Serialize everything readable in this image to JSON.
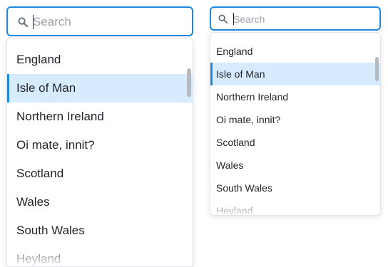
{
  "colors": {
    "accent": "#1f86e2",
    "selected_bg": "#d6ebfd",
    "text": "#1f2328",
    "placeholder": "#9aa1a9"
  },
  "large_combo": {
    "search": {
      "icon": "search-icon",
      "placeholder": "Search",
      "value": ""
    },
    "options": [
      "England",
      "Isle of Man",
      "Northern Ireland",
      "Oi mate, innit?",
      "Scotland",
      "Wales",
      "South Wales",
      "Heyland"
    ],
    "selected": "Isle of Man"
  },
  "small_combo": {
    "search": {
      "icon": "search-icon",
      "placeholder": "Search",
      "value": ""
    },
    "options": [
      "England",
      "Isle of Man",
      "Northern Ireland",
      "Oi mate, innit?",
      "Scotland",
      "Wales",
      "South Wales",
      "Heyland"
    ],
    "selected": "Isle of Man"
  }
}
